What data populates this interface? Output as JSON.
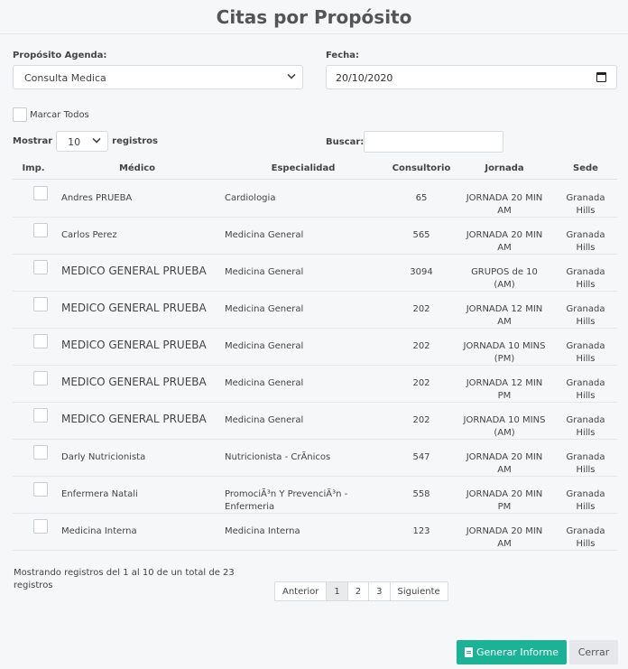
{
  "title": "Citas por Propósito",
  "filters": {
    "proposito_label": "Propósito Agenda:",
    "proposito_value": "Consulta Medica",
    "fecha_label": "Fecha:",
    "fecha_value": "20/10/2020"
  },
  "marcar_todos": "Marcar Todos",
  "length": {
    "prefix": "Mostrar",
    "value": "10",
    "suffix": "registros"
  },
  "search_label": "Buscar:",
  "columns": [
    "Imp.",
    "Médico",
    "Especialidad",
    "Consultorio",
    "Jornada",
    "Sede"
  ],
  "rows": [
    {
      "medico": "Andres  PRUEBA",
      "especialidad": "Cardiologia",
      "consultorio": "65",
      "jornada": "JORNADA 20 MIN AM",
      "sede": "Granada Hills"
    },
    {
      "medico": "Carlos Perez",
      "especialidad": "Medicina General",
      "consultorio": "565",
      "jornada": "JORNADA 20 MIN AM",
      "sede": "Granada Hills"
    },
    {
      "medico": "MEDICO GENERAL PRUEBA",
      "especialidad": "Medicina General",
      "consultorio": "3094",
      "jornada": "GRUPOS de 10 (AM)",
      "sede": "Granada Hills"
    },
    {
      "medico": "MEDICO GENERAL PRUEBA",
      "especialidad": "Medicina General",
      "consultorio": "202",
      "jornada": "JORNADA 12 MIN AM",
      "sede": "Granada Hills"
    },
    {
      "medico": "MEDICO GENERAL PRUEBA",
      "especialidad": "Medicina General",
      "consultorio": "202",
      "jornada": "JORNADA 10 MINS (PM)",
      "sede": "Granada Hills"
    },
    {
      "medico": "MEDICO GENERAL PRUEBA",
      "especialidad": "Medicina General",
      "consultorio": "202",
      "jornada": "JORNADA 12 MIN PM",
      "sede": "Granada Hills"
    },
    {
      "medico": "MEDICO GENERAL PRUEBA",
      "especialidad": "Medicina General",
      "consultorio": "202",
      "jornada": "JORNADA 10 MINS (AM)",
      "sede": "Granada Hills"
    },
    {
      "medico": "Darly  Nutricionista",
      "especialidad": "Nutricionista - CrÃ­nicos",
      "consultorio": "547",
      "jornada": "JORNADA 20 MIN AM",
      "sede": "Granada Hills"
    },
    {
      "medico": "Enfermera Natali",
      "especialidad": "PromociÃ³n Y PrevenciÃ³n - Enfermeria",
      "consultorio": "558",
      "jornada": "JORNADA 20 MIN PM",
      "sede": "Granada Hills"
    },
    {
      "medico": "Medicina Interna",
      "especialidad": "Medicina Interna",
      "consultorio": "123",
      "jornada": "JORNADA 20 MIN AM",
      "sede": "Granada Hills"
    }
  ],
  "info": "Mostrando registros del 1 al 10 de un total de 23 registros",
  "pager": {
    "prev": "Anterior",
    "pages": [
      "1",
      "2",
      "3"
    ],
    "next": "Siguiente"
  },
  "buttons": {
    "generar": "Generar Informe",
    "cerrar": "Cerrar"
  }
}
